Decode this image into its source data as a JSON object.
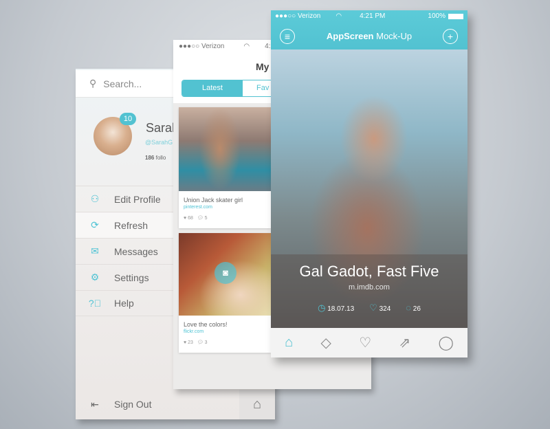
{
  "colors": {
    "accent": "#52c2d1"
  },
  "sidebar": {
    "search_placeholder": "Search...",
    "profile": {
      "name": "Sarah",
      "handle": "@SarahG",
      "badge": "10",
      "followers_count": "186",
      "followers_label": "follo"
    },
    "items": [
      {
        "label": "Edit Profile",
        "icon": "user-icon"
      },
      {
        "label": "Refresh",
        "icon": "refresh-icon"
      },
      {
        "label": "Messages",
        "icon": "envelope-icon"
      },
      {
        "label": "Settings",
        "icon": "gear-icon"
      },
      {
        "label": "Help",
        "icon": "help-icon"
      }
    ],
    "sign_out": "Sign Out"
  },
  "feed": {
    "status": {
      "carrier": "●●●○○ Verizon",
      "time": "4:2"
    },
    "title": "My",
    "tabs": [
      {
        "label": "Latest",
        "active": true
      },
      {
        "label": "Fav",
        "active": false
      }
    ],
    "cards": [
      {
        "caption": "Union Jack skater girl",
        "source": "pinterest.com",
        "likes": "68",
        "comments": "5"
      },
      {
        "caption": "Love the colors!",
        "source": "flickr.com",
        "likes": "23",
        "comments": "3"
      }
    ]
  },
  "detail": {
    "status": {
      "carrier": "●●●○○ Verizon",
      "time": "4:21 PM",
      "battery": "100%"
    },
    "title_bold": "AppScreen",
    "title_rest": "Mock-Up",
    "photo_title": "Gal Gadot, Fast Five",
    "photo_source": "m.imdb.com",
    "date": "18.07.13",
    "likes": "324",
    "comments": "26",
    "tabbar": [
      "home-icon",
      "tag-icon",
      "heart-icon",
      "share-icon",
      "chat-icon"
    ]
  }
}
